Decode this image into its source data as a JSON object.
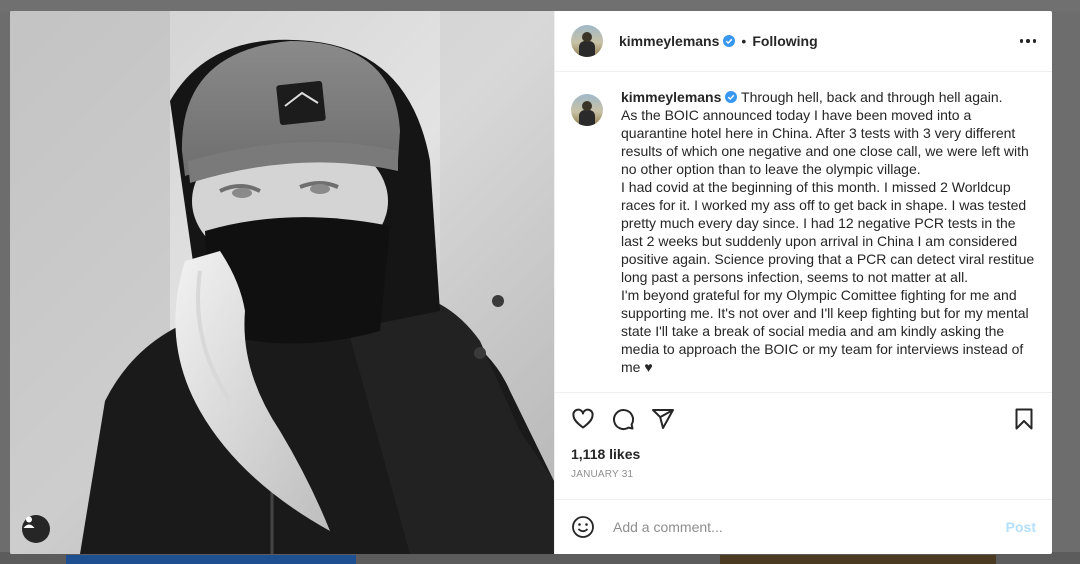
{
  "post": {
    "username": "kimmeylemans",
    "dot": "•",
    "follow_status": "Following",
    "caption": "Through hell, back and through hell again.\nAs the BOIC announced today I have been moved into a quarantine hotel here in China. After 3 tests with 3 very different results of which one negative and one close call, we were left with no other option than to leave the olympic village.\nI had covid at the beginning of this month. I missed 2 Worldcup races for it. I worked my ass off to get back in shape. I was tested pretty much every day since. I had 12 negative PCR tests in the last 2 weeks but suddenly upon arrival in China I am considered positive again. Science proving that a PCR can detect viral restitue long past a persons infection, seems to not matter at all.\nI'm beyond grateful for my Olympic Comittee fighting for me and supporting me. It's not over and I'll keep fighting but for my mental state I'll take a break of social media and am kindly asking the media to approach the BOIC or my team for interviews instead of me ♥",
    "likes": "1,118 likes",
    "date": "JANUARY 31"
  },
  "comment": {
    "placeholder": "Add a comment...",
    "post_label": "Post"
  },
  "colors": {
    "verified": "#3897f0",
    "post_disabled": "#b2dffc",
    "text": "#262626",
    "muted": "#8e8e8e"
  },
  "icons": [
    "heart-icon",
    "comment-icon",
    "share-icon",
    "bookmark-icon",
    "emoji-icon",
    "more-icon",
    "verified-icon",
    "user-tag-icon"
  ]
}
